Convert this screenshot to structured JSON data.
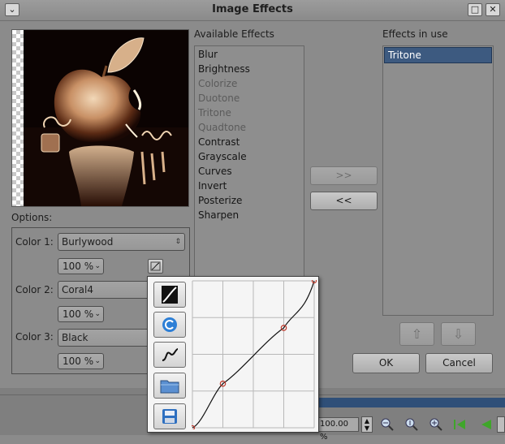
{
  "window": {
    "title": "Image Effects",
    "menu_glyph": "⌄",
    "restore_glyph": "□",
    "close_glyph": "✕"
  },
  "labels": {
    "available": "Available Effects",
    "in_use": "Effects in use",
    "options": "Options:"
  },
  "available_effects": [
    {
      "label": "Blur",
      "enabled": true
    },
    {
      "label": "Brightness",
      "enabled": true
    },
    {
      "label": "Colorize",
      "enabled": false
    },
    {
      "label": "Duotone",
      "enabled": false
    },
    {
      "label": "Tritone",
      "enabled": false
    },
    {
      "label": "Quadtone",
      "enabled": false
    },
    {
      "label": "Contrast",
      "enabled": true
    },
    {
      "label": "Grayscale",
      "enabled": true
    },
    {
      "label": "Curves",
      "enabled": true
    },
    {
      "label": "Invert",
      "enabled": true
    },
    {
      "label": "Posterize",
      "enabled": true
    },
    {
      "label": "Sharpen",
      "enabled": true
    }
  ],
  "effects_in_use": [
    {
      "label": "Tritone",
      "selected": true
    }
  ],
  "buttons": {
    "add": ">>",
    "remove": "<<",
    "ok": "OK",
    "cancel": "Cancel",
    "move_up": "⇧",
    "move_down": "⇩"
  },
  "options": {
    "color1": {
      "label": "Color 1:",
      "value": "Burlywood",
      "percent": "100 %"
    },
    "color2": {
      "label": "Color 2:",
      "value": "Coral4",
      "percent": "100 %"
    },
    "color3": {
      "label": "Color 3:",
      "value": "Black",
      "percent": "100 %"
    }
  },
  "statusbar": {
    "zoom": "100.00 %"
  },
  "colors": {
    "selection": "#3d5a80",
    "curve_point": "#c0392b",
    "nav_green": "#3fa62a"
  },
  "curve_points": [
    [
      0,
      0
    ],
    [
      0.25,
      0.3
    ],
    [
      0.75,
      0.68
    ],
    [
      1,
      1
    ]
  ]
}
